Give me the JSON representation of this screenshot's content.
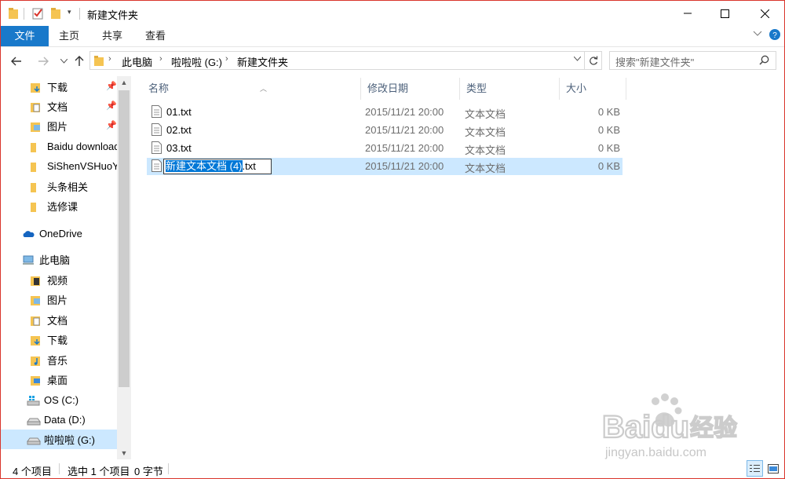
{
  "window": {
    "title": "新建文件夹"
  },
  "ribbon": {
    "tabs": [
      "文件",
      "主页",
      "共享",
      "查看"
    ]
  },
  "address": {
    "crumbs": [
      "此电脑",
      "啦啦啦 (G:)",
      "新建文件夹"
    ],
    "search_placeholder": "搜索\"新建文件夹\""
  },
  "navpane": {
    "quick_access": [
      {
        "label": "下载",
        "icon": "download-folder-icon",
        "pinned": true
      },
      {
        "label": "文档",
        "icon": "documents-folder-icon",
        "pinned": true
      },
      {
        "label": "图片",
        "icon": "pictures-folder-icon",
        "pinned": true
      },
      {
        "label": "Baidu download",
        "icon": "folder-icon",
        "pinned": false
      },
      {
        "label": "SiShenVSHuoYing",
        "icon": "folder-icon",
        "pinned": false
      },
      {
        "label": "头条相关",
        "icon": "folder-icon",
        "pinned": false
      },
      {
        "label": "选修课",
        "icon": "folder-icon",
        "pinned": false
      }
    ],
    "onedrive": "OneDrive",
    "this_pc": "此电脑",
    "pc_items": [
      {
        "label": "视频",
        "icon": "videos-folder-icon"
      },
      {
        "label": "图片",
        "icon": "pictures-folder-icon"
      },
      {
        "label": "文档",
        "icon": "documents-folder-icon"
      },
      {
        "label": "下载",
        "icon": "download-folder-icon"
      },
      {
        "label": "音乐",
        "icon": "music-folder-icon"
      },
      {
        "label": "桌面",
        "icon": "desktop-folder-icon"
      },
      {
        "label": "OS (C:)",
        "icon": "windows-drive-icon"
      },
      {
        "label": "Data (D:)",
        "icon": "drive-icon"
      },
      {
        "label": "啦啦啦 (G:)",
        "icon": "drive-icon",
        "selected": true
      }
    ]
  },
  "columns": [
    "名称",
    "修改日期",
    "类型",
    "大小"
  ],
  "files": [
    {
      "name": "01.txt",
      "date": "2015/11/21 20:00",
      "type": "文本文档",
      "size": "0 KB"
    },
    {
      "name": "02.txt",
      "date": "2015/11/21 20:00",
      "type": "文本文档",
      "size": "0 KB"
    },
    {
      "name": "03.txt",
      "date": "2015/11/21 20:00",
      "type": "文本文档",
      "size": "0 KB"
    },
    {
      "name_selected_part": "新建文本文档 (4)",
      "name_ext": ".txt",
      "date": "2015/11/21 20:00",
      "type": "文本文档",
      "size": "0 KB",
      "renaming": true
    }
  ],
  "status": {
    "count": "4 个项目",
    "selection": "选中 1 个项目",
    "bytes": "0 字节"
  },
  "watermark": {
    "brand": "Baidu",
    "brand_cn": "经验",
    "url": "jingyan.baidu.com"
  },
  "colors": {
    "accent": "#1979ca",
    "selection": "#cce8ff",
    "folder": "#f5c452",
    "window_border": "#d9342b"
  }
}
